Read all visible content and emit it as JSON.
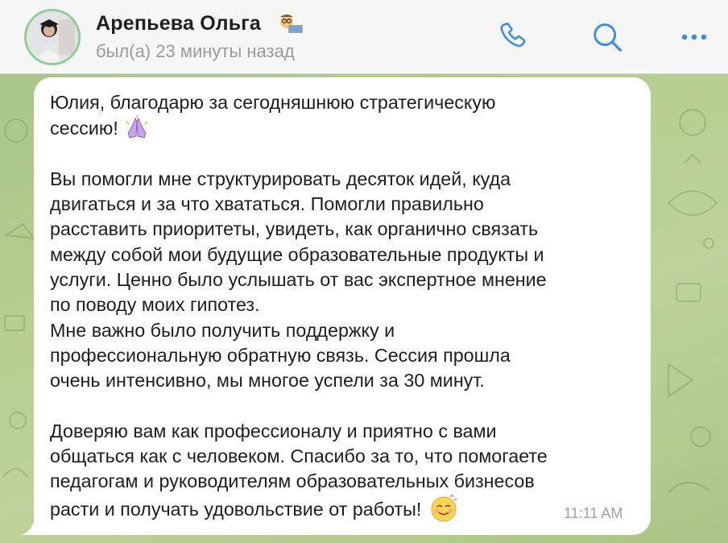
{
  "header": {
    "contact_name": "Арепьева Ольга",
    "status": "был(а) 23 минуты назад",
    "name_emoji": "teacher-laptop-emoji",
    "icons": [
      "phone-icon",
      "search-icon",
      "more-icon"
    ]
  },
  "message": {
    "text": "Юлия, благодарю за сегодняшнюю стратегическую\nсессию!\n\nВы помогли мне структурировать десяток идей, куда\nдвигаться и за что хвататься. Помогли правильно\nрасставить приоритеты, увидеть, как органично связать\nмежду собой мои будущие образовательные продукты и\nуслуги. Ценно было услышать от вас экспертное мнение\nпо поводу моих гипотез.\nМне важно было получить поддержку и\nпрофессиональную обратную связь. Сессия прошла\nочень интенсивно, мы многое успели за 30 минут.\n\nДоверяю вам как профессионалу и приятно с вами\nобщаться как с человеком. Спасибо за то, что помогаете\nпедагогам и руководителям образовательных бизнесов\nрасти и получать удовольствие от работы!",
    "time": "11:11 AM",
    "emojis": [
      "folded-hands-emoji",
      "smiling-face-emoji"
    ]
  },
  "colors": {
    "accent": "#3a8ee6",
    "chat_background": "#b3cb8e",
    "bubble": "#ffffff"
  }
}
